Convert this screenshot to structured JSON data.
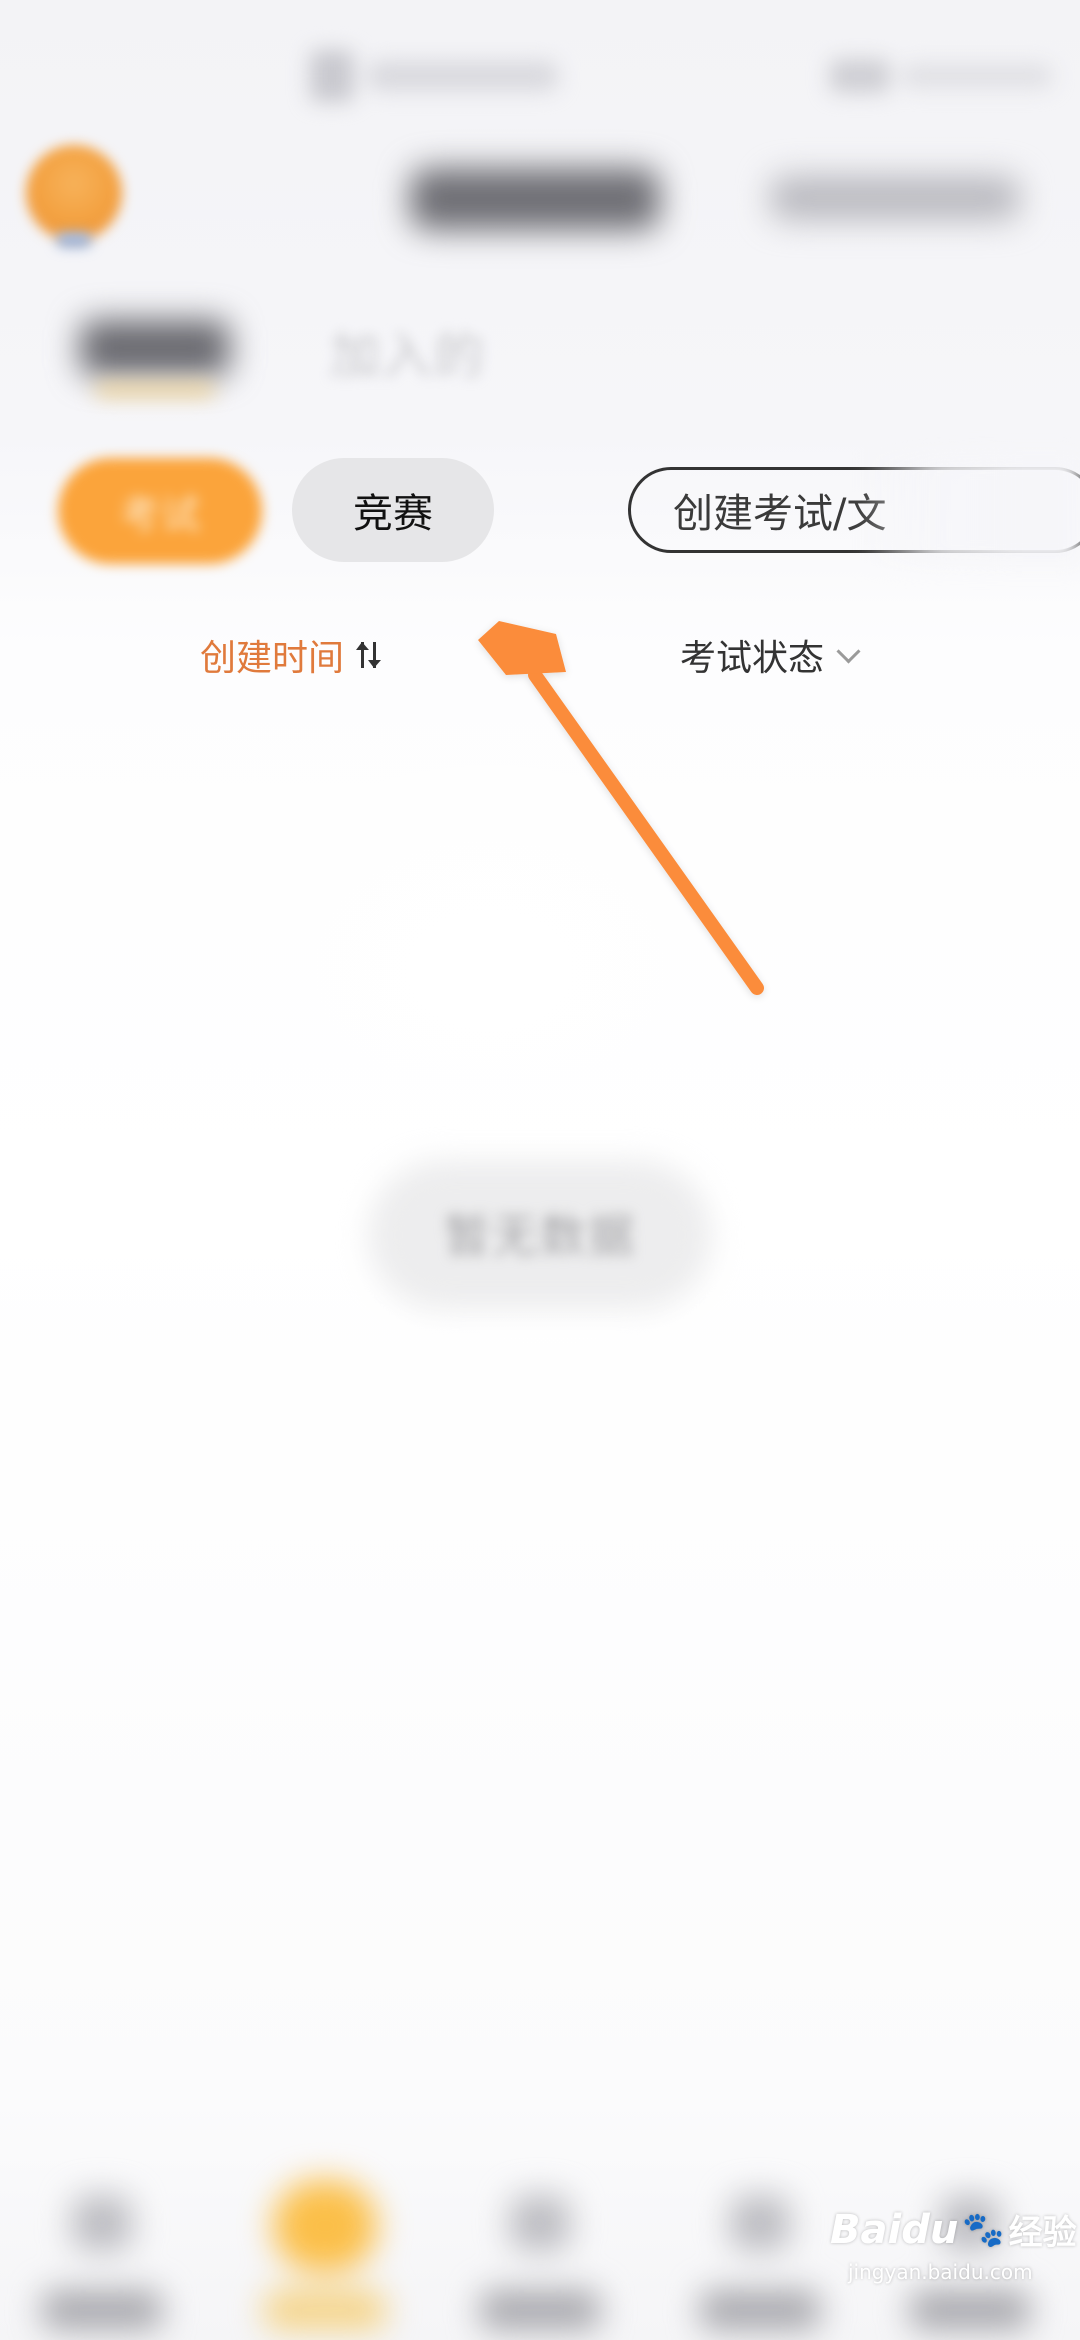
{
  "tabs": {
    "joined_label": "加入的"
  },
  "segments": {
    "exam_label": "考试",
    "contest_label": "竞赛",
    "create_label": "创建考试/文"
  },
  "filters": {
    "sort_label": "创建时间",
    "status_label": "考试状态"
  },
  "empty_state": {
    "text": "暂无数据"
  },
  "annotation": {
    "arrow_color": "#fb8c3a"
  },
  "colors": {
    "accent": "#fba43b",
    "sort_active": "#e07a3c"
  },
  "watermark": {
    "brand": "Baidu",
    "suffix": "经验",
    "url": "jingyan.baidu.com"
  },
  "icons": {
    "sort": "sort-arrows-icon",
    "dropdown": "chevron-down-icon"
  }
}
